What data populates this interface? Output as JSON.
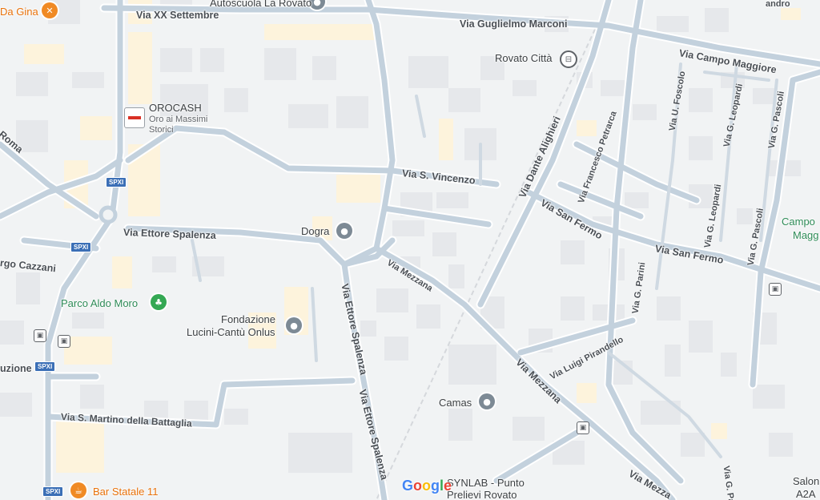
{
  "streets": {
    "via_xx_settembre": "Via XX Settembre",
    "via_guglielmo_marconi": "Via Guglielmo Marconi",
    "via_campo_maggiore": "Via Campo Maggiore",
    "via_s_vincenzo": "Via S. Vincenzo",
    "via_ettore_spalenza_1": "Via Ettore Spalenza",
    "via_ettore_spalenza_2": "Via Ettore Spalenza",
    "via_ettore_spalenza_3": "Via Ettore Spalenza",
    "via_mezzana_1": "Via Mezzana",
    "via_mezzana_2": "Via Mezzana",
    "via_mezzana_3": "Via Mezza",
    "via_dante_alighieri": "Via Dante Alighieri",
    "via_francesco_petrarca": "Via Francesco Petrarca",
    "via_san_fermo_1": "Via San Fermo",
    "via_san_fermo_2": "Via San Fermo",
    "via_u_foscolo": "Via U. Foscolo",
    "via_g_leopardi_1": "Via G. Leopardi",
    "via_g_leopardi_2": "Via G. Leopardi",
    "via_g_pascoli_1": "Via G. Pascoli",
    "via_g_pascoli_2": "Via G. Pascoli",
    "via_g_parini_1": "Via G. Parini",
    "via_g_parini_2": "Via G. Pa",
    "via_luigi_pirandello": "Via Luigi Pirandello",
    "via_s_martino": "Via S. Martino della Battaglia",
    "roma": "Roma",
    "rgo_cazzani": "rgo Cazzani",
    "uzione": "uzione",
    "andro": "andro"
  },
  "pois": {
    "autoscuola": "Autoscuola La Rovato",
    "da_gina": "Da Gina",
    "rovato_citta": "Rovato Città",
    "orocash_name": "OROCASH",
    "orocash_sub1": "Oro ai Massimi",
    "orocash_sub2": "Storici",
    "dogra": "Dogra",
    "parco_aldo_moro": "Parco Aldo Moro",
    "fondazione_1": "Fondazione",
    "fondazione_2": "Lucini-Cantù Onlus",
    "camas": "Camas",
    "bar_statale": "Bar Statale 11",
    "synlab_1": "SYNLAB - Punto",
    "synlab_2": "Prelievi Rovato",
    "campo_1": "Campo",
    "campo_2": "Magg",
    "salon_1": "Salon",
    "salon_2": "A2A"
  },
  "shields": [
    "SPXI",
    "SPXI",
    "SPXI",
    "SPXI"
  ],
  "attribution": [
    "G",
    "o",
    "o",
    "g",
    "l",
    "e"
  ],
  "colors": {
    "road": "#c3d1dd",
    "road_outline": "#ffffff",
    "building": "#e8eaed",
    "highlight_block": "#fdf3dc",
    "poi_gray": "#7d8a95",
    "park_green": "#34a853",
    "food_orange": "#f08a24",
    "shield_blue": "#3b6fb6"
  },
  "icons": {
    "poi": "map-pin-icon",
    "park": "tree-icon",
    "food": "fork-knife-icon",
    "cafe": "coffee-cup-icon",
    "train": "train-station-icon",
    "bus": "bus-stop-icon"
  }
}
